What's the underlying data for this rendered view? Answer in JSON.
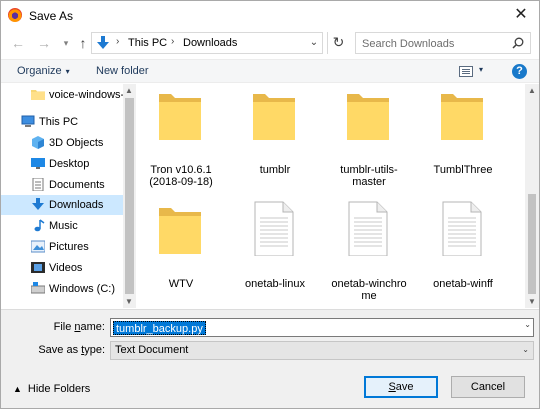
{
  "window": {
    "title": "Save As",
    "close_glyph": "✕"
  },
  "navigation": {
    "back_glyph": "←",
    "forward_glyph": "→",
    "recent_glyph": "▾",
    "up_glyph": "↑",
    "breadcrumbs": [
      "This PC",
      "Downloads"
    ],
    "separator": "›",
    "dropdown_glyph": "⌄",
    "refresh_glyph": "↻",
    "search_placeholder": "Search Downloads"
  },
  "toolbar": {
    "organize_label": "Organize",
    "organize_caret": "▾",
    "new_folder_label": "New folder",
    "view_caret": "▾",
    "help_label": "?"
  },
  "sidebar": {
    "items": [
      {
        "label": "voice-windows-",
        "icon": "folder-icon"
      },
      {
        "label": "This PC",
        "icon": "computer-icon"
      },
      {
        "label": "3D Objects",
        "icon": "cube-icon"
      },
      {
        "label": "Desktop",
        "icon": "desktop-icon"
      },
      {
        "label": "Documents",
        "icon": "documents-icon"
      },
      {
        "label": "Downloads",
        "icon": "download-icon",
        "selected": true
      },
      {
        "label": "Music",
        "icon": "music-icon"
      },
      {
        "label": "Pictures",
        "icon": "pictures-icon"
      },
      {
        "label": "Videos",
        "icon": "videos-icon"
      },
      {
        "label": "Windows (C:)",
        "icon": "drive-icon"
      }
    ]
  },
  "files": [
    {
      "label": "Tron v10.6.1\n(2018-09-18)",
      "icon": "folder-icon"
    },
    {
      "label": "tumblr",
      "icon": "folder-icon"
    },
    {
      "label": "tumblr-utils-master",
      "icon": "folder-icon"
    },
    {
      "label": "TumblThree",
      "icon": "folder-icon"
    },
    {
      "label": "WTV",
      "icon": "folder-icon"
    },
    {
      "label": "onetab-linux",
      "icon": "text-file-icon"
    },
    {
      "label": "onetab-winchro\nme",
      "icon": "text-file-icon"
    },
    {
      "label": "onetab-winff",
      "icon": "text-file-icon"
    }
  ],
  "form": {
    "file_name_label_pre": "File ",
    "file_name_label_u": "n",
    "file_name_label_post": "ame:",
    "file_name_value": "tumblr_backup.py",
    "save_type_label_pre": "Save as ",
    "save_type_label_u": "t",
    "save_type_label_post": "ype:",
    "save_type_value": "Text Document",
    "hide_folders_label": "Hide Folders",
    "hide_folders_caret": "▲",
    "save_button_u": "S",
    "save_button_post": "ave",
    "cancel_button": "Cancel",
    "dropdown_glyph": "⌄"
  },
  "colors": {
    "accent": "#0078d7",
    "selection_bg": "#cce8ff",
    "folder_yellow": "#ffd966",
    "folder_dark": "#e8b84a"
  }
}
